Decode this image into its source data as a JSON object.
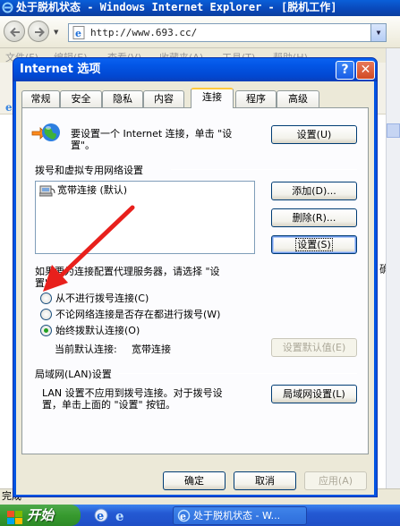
{
  "ie_window": {
    "title": "处于脱机状态 - Windows Internet Explorer - [脱机工作]",
    "address": "http://www.693.cc/",
    "menu": [
      "文件(F)",
      "编辑(E)",
      "查看(V)",
      "收藏夹(A)",
      "工具(T)",
      "帮助(H)"
    ],
    "side_text": "确保",
    "status_text": "完成"
  },
  "taskbar": {
    "start_label": "开始",
    "task_title": "处于脱机状态 - W..."
  },
  "dialog": {
    "title": "Internet 选项",
    "help_glyph": "?",
    "close_glyph": "✕",
    "tabs": [
      "常规",
      "安全",
      "隐私",
      "内容",
      "连接",
      "程序",
      "高级"
    ],
    "active_tab": "连接",
    "setup_text_line1": "要设置一个 Internet 连接，单击 \"设",
    "setup_text_line2": "置\"。",
    "setup_button": "设置(U)",
    "dialup_header": "拨号和虚拟专用网络设置",
    "connections": [
      {
        "name": "宽带连接 (默认)"
      }
    ],
    "add_button": "添加(D)...",
    "remove_button": "删除(R)...",
    "settings_button": "设置(S)",
    "proxy_text_line1": "如果要为连接配置代理服务器，请选择 \"设",
    "proxy_text_line2": "置\"。",
    "radio_options": [
      {
        "label": "从不进行拨号连接(C)",
        "checked": false
      },
      {
        "label": "不论网络连接是否存在都进行拨号(W)",
        "checked": false
      },
      {
        "label": "始终拨默认连接(O)",
        "checked": true
      }
    ],
    "current_default_label": "当前默认连接:",
    "current_default_value": "宽带连接",
    "set_default_button": "设置默认值(E)",
    "lan_header": "局域网(LAN)设置",
    "lan_text_line1": "LAN 设置不应用到拨号连接。对于拨号设",
    "lan_text_line2": "置，单击上面的 \"设置\" 按钮。",
    "lan_button": "局域网设置(L)",
    "ok_button": "确定",
    "cancel_button": "取消",
    "apply_button": "应用(A)"
  },
  "colors": {
    "annotation_arrow": "#e8201c",
    "xp_blue": "#0054e3",
    "dialog_face": "#ece9d8"
  }
}
